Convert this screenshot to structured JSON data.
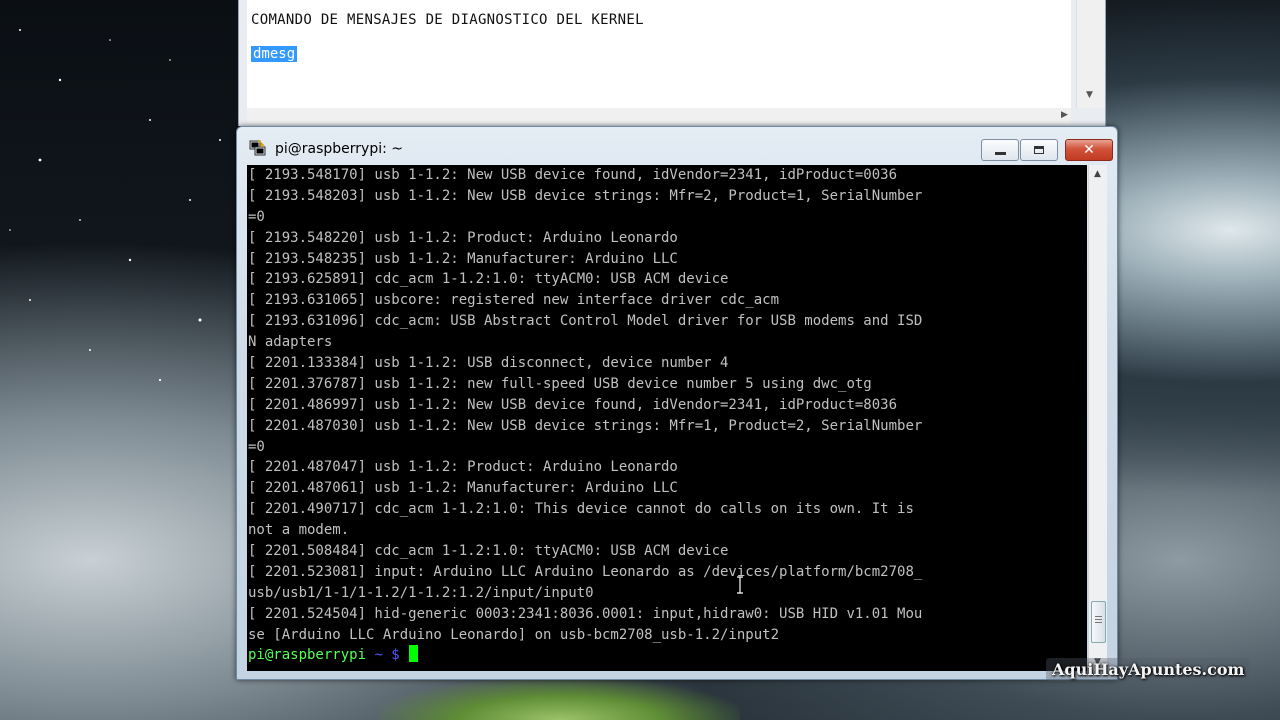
{
  "editor": {
    "heading": "COMANDO DE MENSAJES DE DIAGNOSTICO DEL KERNEL",
    "command": "dmesg"
  },
  "terminal": {
    "title": "pi@raspberrypi: ~",
    "lines": [
      "[ 2193.548170] usb 1-1.2: New USB device found, idVendor=2341, idProduct=0036",
      "[ 2193.548203] usb 1-1.2: New USB device strings: Mfr=2, Product=1, SerialNumber",
      "=0",
      "[ 2193.548220] usb 1-1.2: Product: Arduino Leonardo",
      "[ 2193.548235] usb 1-1.2: Manufacturer: Arduino LLC",
      "[ 2193.625891] cdc_acm 1-1.2:1.0: ttyACM0: USB ACM device",
      "[ 2193.631065] usbcore: registered new interface driver cdc_acm",
      "[ 2193.631096] cdc_acm: USB Abstract Control Model driver for USB modems and ISD",
      "N adapters",
      "[ 2201.133384] usb 1-1.2: USB disconnect, device number 4",
      "[ 2201.376787] usb 1-1.2: new full-speed USB device number 5 using dwc_otg",
      "[ 2201.486997] usb 1-1.2: New USB device found, idVendor=2341, idProduct=8036",
      "[ 2201.487030] usb 1-1.2: New USB device strings: Mfr=1, Product=2, SerialNumber",
      "=0",
      "[ 2201.487047] usb 1-1.2: Product: Arduino Leonardo",
      "[ 2201.487061] usb 1-1.2: Manufacturer: Arduino LLC",
      "[ 2201.490717] cdc_acm 1-1.2:1.0: This device cannot do calls on its own. It is",
      "not a modem.",
      "[ 2201.508484] cdc_acm 1-1.2:1.0: ttyACM0: USB ACM device",
      "[ 2201.523081] input: Arduino LLC Arduino Leonardo as /devices/platform/bcm2708_",
      "usb/usb1/1-1/1-1.2/1-1.2:1.2/input/input0",
      "[ 2201.524504] hid-generic 0003:2341:8036.0001: input,hidraw0: USB HID v1.01 Mou",
      "se [Arduino LLC Arduino Leonardo] on usb-bcm2708_usb-1.2/input2"
    ],
    "prompt_user": "pi@raspberrypi",
    "prompt_path": "~ $"
  },
  "watermark": "AquiHayApuntes.com",
  "colors": {
    "terminal_text": "#c0c0c0",
    "prompt_green": "#54ff54",
    "prompt_blue": "#5454ff",
    "selection": "#3399ff"
  }
}
